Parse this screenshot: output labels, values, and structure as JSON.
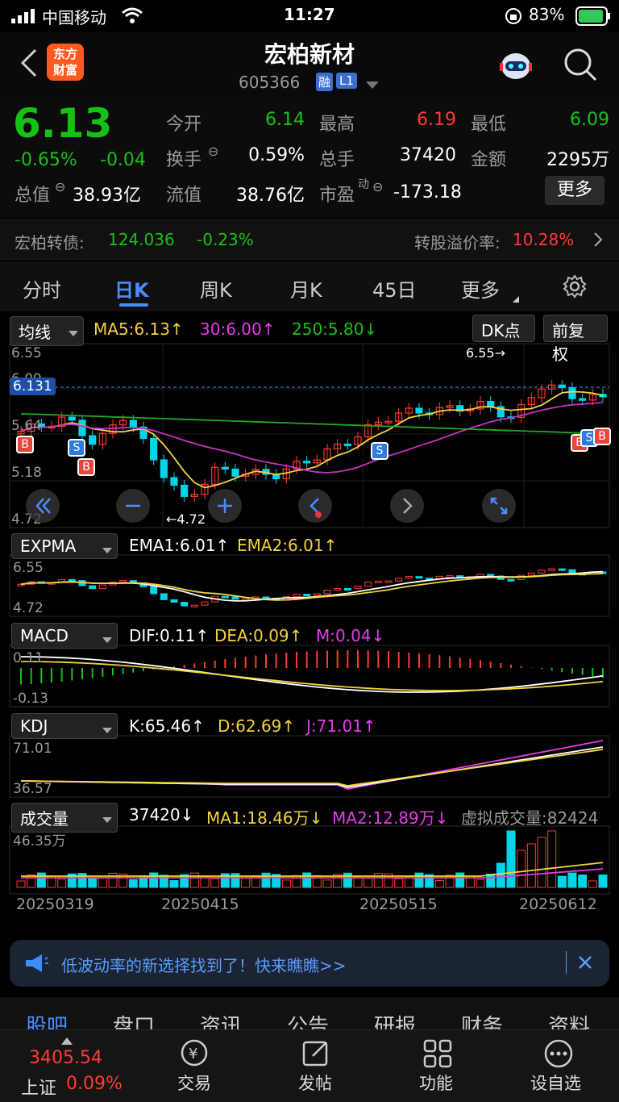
{
  "status_bar": {
    "carrier": "中国移动",
    "time": "11:27",
    "battery": "83%"
  },
  "header": {
    "logo_line1": "东方",
    "logo_line2": "财富",
    "title": "宏柏新材",
    "code": "605366",
    "badge_rong": "融",
    "badge_level": "L1"
  },
  "quote": {
    "price": "6.13",
    "change_pct": "-0.65%",
    "change": "-0.04",
    "open_label": "今开",
    "open": "6.14",
    "high_label": "最高",
    "high": "6.19",
    "low_label": "最低",
    "low": "6.09",
    "turnover_label": "换手",
    "turnover": "0.59%",
    "volume_label": "总手",
    "volume": "37420",
    "amount_label": "金额",
    "amount": "2295万",
    "mcap_label": "总值",
    "mcap": "38.93亿",
    "float_label": "流值",
    "float": "38.76亿",
    "pe_label": "市盈",
    "pe_sup": "动",
    "pe": "-173.18",
    "more_button": "更多"
  },
  "bond": {
    "name": "宏柏转债:",
    "price": "124.036",
    "change": "-0.23%",
    "premium_label": "转股溢价率:",
    "premium": "10.28%"
  },
  "tabs": [
    "分时",
    "日K",
    "周K",
    "月K",
    "45日",
    "更多"
  ],
  "active_tab": "日K",
  "main_chart": {
    "indicator_select": "均线",
    "ma5": "MA5:6.13↑",
    "ma30": "30:6.00↑",
    "ma250": "250:5.80↓",
    "dk_button": "DK点",
    "adjust_button": "前复权",
    "y_ticks": [
      "6.55",
      "6.09",
      "5.64",
      "5.18",
      "4.72"
    ],
    "current_price_tag": "6.131",
    "high_mark": "6.55→",
    "low_mark": "←4.72",
    "signals": [
      "B",
      "S",
      "B",
      "S",
      "B",
      "S",
      "B"
    ]
  },
  "expma": {
    "select": "EXPMA",
    "ema1": "EMA1:6.01↑",
    "ema2": "EMA2:6.01↑",
    "y_top": "6.55",
    "y_bottom": "4.72"
  },
  "macd": {
    "select": "MACD",
    "dif": "DIF:0.11↑",
    "dea": "DEA:0.09↑",
    "m": "M:0.04↓",
    "y_top": "0.11",
    "y_bottom": "-0.13"
  },
  "kdj": {
    "select": "KDJ",
    "k": "K:65.46↑",
    "d": "D:62.69↑",
    "j": "J:71.01↑",
    "y_top": "71.01",
    "y_bottom": "36.57"
  },
  "vol": {
    "select": "成交量",
    "vol": "37420↓",
    "ma1": "MA1:18.46万↓",
    "ma2": "MA2:12.89万↓",
    "virtual": "虚拟成交量:82424",
    "y_top": "46.35万"
  },
  "x_dates": [
    "20250319",
    "20250415",
    "20250515",
    "20250612"
  ],
  "banner": {
    "text": "低波动率的新选择找到了！快来瞧瞧>>"
  },
  "bottom_tabs": [
    "股吧",
    "盘口",
    "资讯",
    "公告",
    "研报",
    "财务",
    "资料"
  ],
  "footer": {
    "index_value": "3405.54",
    "index_name": "上证",
    "index_change": "0.09%",
    "trade": "交易",
    "post": "发帖",
    "function": "功能",
    "watchlist": "设自选"
  },
  "colors": {
    "up": "#ff3b30",
    "down": "#00d4e8",
    "green": "#16c116",
    "ma5": "#f3d33c",
    "ma30": "#c832c8",
    "ma250": "#21a821"
  }
}
